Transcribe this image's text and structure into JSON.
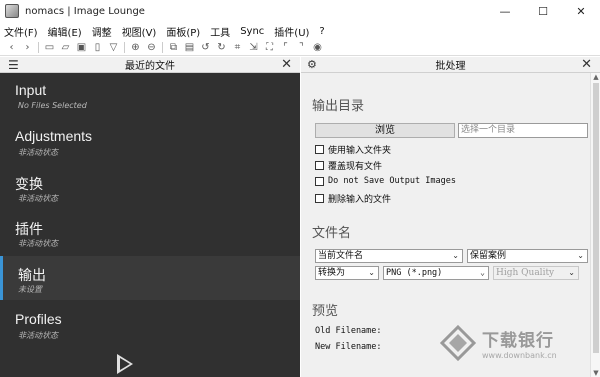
{
  "window": {
    "title": "nomacs | Image Lounge",
    "minimize": "—",
    "maximize": "☐",
    "close": "✕"
  },
  "menu": [
    "文件(F)",
    "编辑(E)",
    "调整",
    "视图(V)",
    "面板(P)",
    "工具",
    "Sync",
    "插件(U)",
    "?"
  ],
  "left_dock": {
    "title": "最近的文件",
    "close": "✕",
    "sections": [
      {
        "title": "Input",
        "subtitle": "No Files Selected"
      },
      {
        "title": "Adjustments",
        "subtitle": "非活动状态"
      },
      {
        "title": "变换",
        "subtitle": "非活动状态"
      },
      {
        "title": "插件",
        "subtitle": "非活动状态"
      },
      {
        "title": "输出",
        "subtitle": "未设置"
      },
      {
        "title": "Profiles",
        "subtitle": "非活动状态"
      }
    ]
  },
  "right_dock": {
    "title": "批处理",
    "close": "✕",
    "output_dir": {
      "heading": "输出目录",
      "browse_label": "浏览",
      "dir_placeholder": "选择一个目录",
      "options": [
        {
          "label": "使用输入文件夹",
          "checked": false
        },
        {
          "label": "覆盖现有文件",
          "checked": false
        },
        {
          "label": "Do not Save Output Images",
          "checked": false
        },
        {
          "label": "删除输入的文件",
          "checked": false
        }
      ]
    },
    "filename": {
      "heading": "文件名",
      "name_select": "当前文件名",
      "case_select": "保留案例",
      "convert_select": "转换为",
      "format_select": "PNG (*.png)",
      "quality_select": "High Quality"
    },
    "preview": {
      "heading": "预览",
      "old_label": "Old Filename:",
      "new_label": "New Filename:"
    }
  },
  "watermark": {
    "main": "下载银行",
    "sub": "www.downbank.cn"
  }
}
